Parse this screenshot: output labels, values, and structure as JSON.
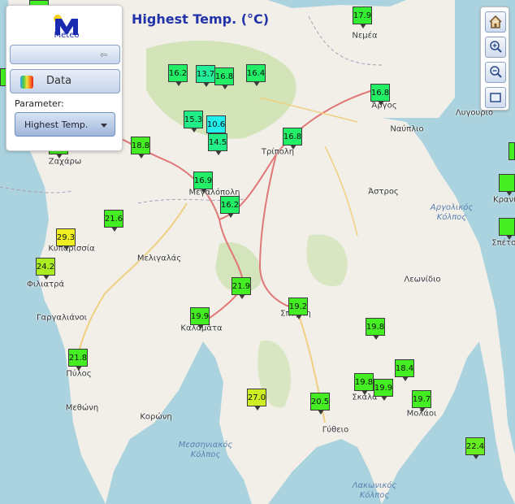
{
  "title": "Highest Temp. (°C)",
  "panel": {
    "logo_text": "Meteo",
    "data_label": "Data",
    "parameter_label": "Parameter:",
    "parameter_value": "Highest Temp."
  },
  "controls": [
    "home-icon",
    "zoom-in-icon",
    "zoom-out-icon",
    "extent-icon"
  ],
  "colors": {
    "land": "#f2efe9",
    "sea": "#aad3df",
    "forest": "#c8e0a8",
    "title": "#2233aa",
    "road_primary": "#e07878",
    "road_secondary": "#f0d080"
  },
  "towns": [
    {
      "name": "Νεμέα"
    },
    {
      "name": "Άργος"
    },
    {
      "name": "Ναύπλιο"
    },
    {
      "name": "Λυγουριό"
    },
    {
      "name": "Τρίπολη"
    },
    {
      "name": "Άστρος"
    },
    {
      "name": "Κρανίδι"
    },
    {
      "name": "Σπέτσες"
    },
    {
      "name": "Ζαχάρω"
    },
    {
      "name": "Μεγαλόπολη"
    },
    {
      "name": "Κυπαρισσία"
    },
    {
      "name": "Μελιγαλάς"
    },
    {
      "name": "Φιλιατρά"
    },
    {
      "name": "Γαργαλιάνοι"
    },
    {
      "name": "Καλαμάτα"
    },
    {
      "name": "Σπάρτη"
    },
    {
      "name": "Λεωνίδιο"
    },
    {
      "name": "Πύλος"
    },
    {
      "name": "Μεθώνη"
    },
    {
      "name": "Κορώνη"
    },
    {
      "name": "Σκάλα"
    },
    {
      "name": "Μολάοι"
    },
    {
      "name": "Γύθειο"
    }
  ],
  "seas": [
    {
      "line1": "Αργολικός",
      "line2": "Κόλπος"
    },
    {
      "line1": "Μεσσηνιακός",
      "line2": "Κόλπος"
    },
    {
      "line1": "Λακωνικός",
      "line2": "Κόλπος"
    }
  ],
  "stations": [
    {
      "value": "17.9",
      "color": "#33ee33"
    },
    {
      "value": "16.2",
      "color": "#22ee66"
    },
    {
      "value": "13.7",
      "color": "#22ee99"
    },
    {
      "value": "16.8",
      "color": "#22ee66"
    },
    {
      "value": "16.4",
      "color": "#22ee66"
    },
    {
      "value": "16.8",
      "color": "#22ee66"
    },
    {
      "value": "15.3",
      "color": "#22ee88"
    },
    {
      "value": "10.6",
      "color": "#22eeee"
    },
    {
      "value": "14.5",
      "color": "#22ee88"
    },
    {
      "value": "16.8",
      "color": "#22ee66"
    },
    {
      "value": "18.8",
      "color": "#44ee22"
    },
    {
      "value": "16.9",
      "color": "#22ee66"
    },
    {
      "value": "16.2",
      "color": "#22ee66"
    },
    {
      "value": "21.6",
      "color": "#44ee22"
    },
    {
      "value": "29.3",
      "color": "#eeee22"
    },
    {
      "value": "24.2",
      "color": "#aaee22"
    },
    {
      "value": "21.9",
      "color": "#44ee22"
    },
    {
      "value": "19.2",
      "color": "#44ee22"
    },
    {
      "value": "19.9",
      "color": "#44ee22"
    },
    {
      "value": "19.8",
      "color": "#44ee22"
    },
    {
      "value": "21.8",
      "color": "#44ee22"
    },
    {
      "value": "18.4",
      "color": "#44ee22"
    },
    {
      "value": "19.8",
      "color": "#44ee22"
    },
    {
      "value": "19.9",
      "color": "#44ee22"
    },
    {
      "value": "27.0",
      "color": "#ccee22"
    },
    {
      "value": "20.5",
      "color": "#44ee22"
    },
    {
      "value": "19.7",
      "color": "#44ee22"
    },
    {
      "value": "22.4",
      "color": "#66ee22"
    }
  ]
}
